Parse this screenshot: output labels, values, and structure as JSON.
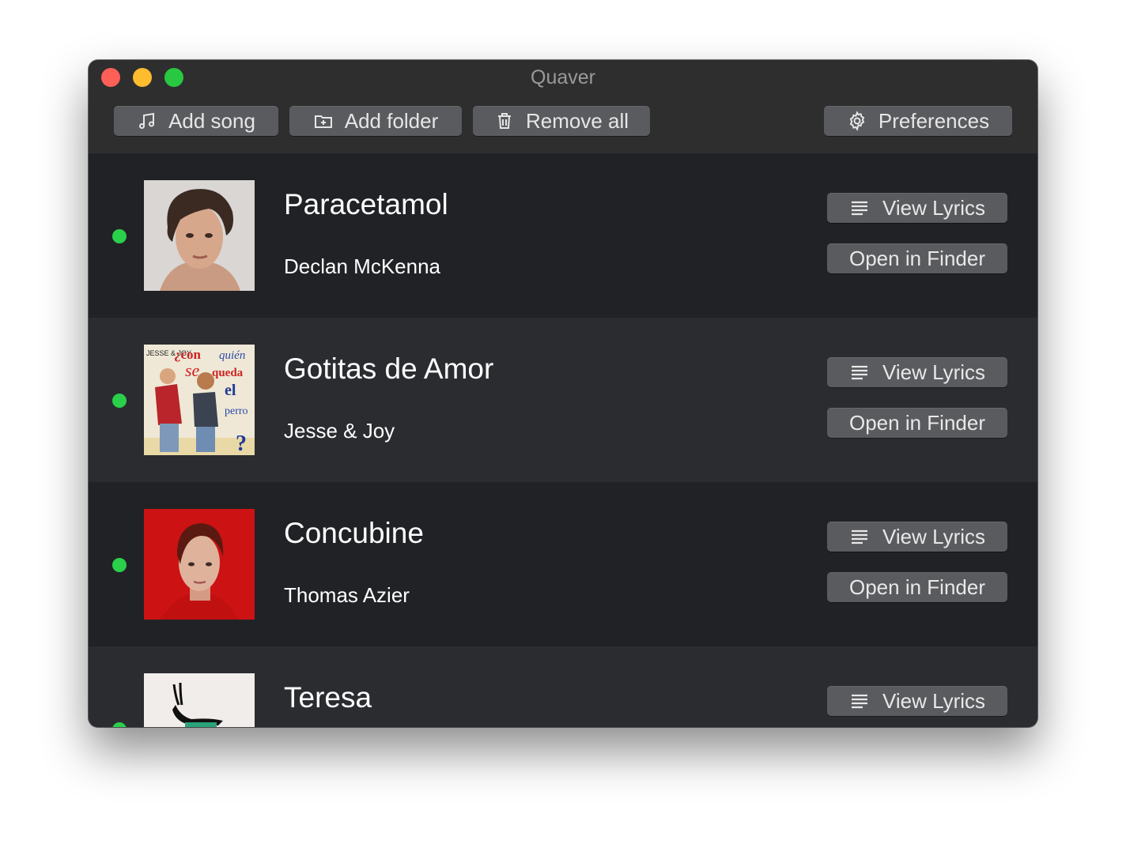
{
  "window": {
    "title": "Quaver"
  },
  "toolbar": {
    "add_song": "Add song",
    "add_folder": "Add folder",
    "remove_all": "Remove all",
    "preferences": "Preferences"
  },
  "colors": {
    "playing_indicator": "#2ad04a",
    "button": "#5a5b5e",
    "row_dark": "#202226",
    "row_light": "#2a2c30"
  },
  "songs": [
    {
      "title": "Paracetamol",
      "artist": "Declan McKenna",
      "view_lyrics": "View Lyrics",
      "open_in_finder": "Open in Finder"
    },
    {
      "title": "Gotitas de Amor",
      "artist": "Jesse & Joy",
      "view_lyrics": "View Lyrics",
      "open_in_finder": "Open in Finder",
      "art_text": [
        "¿con",
        "quién",
        "se",
        "queda",
        "el",
        "perro",
        "?",
        "JESSE & JOY"
      ]
    },
    {
      "title": "Concubine",
      "artist": "Thomas Azier",
      "view_lyrics": "View Lyrics",
      "open_in_finder": "Open in Finder"
    },
    {
      "title": "Teresa",
      "artist": "",
      "view_lyrics": "View Lyrics"
    }
  ]
}
